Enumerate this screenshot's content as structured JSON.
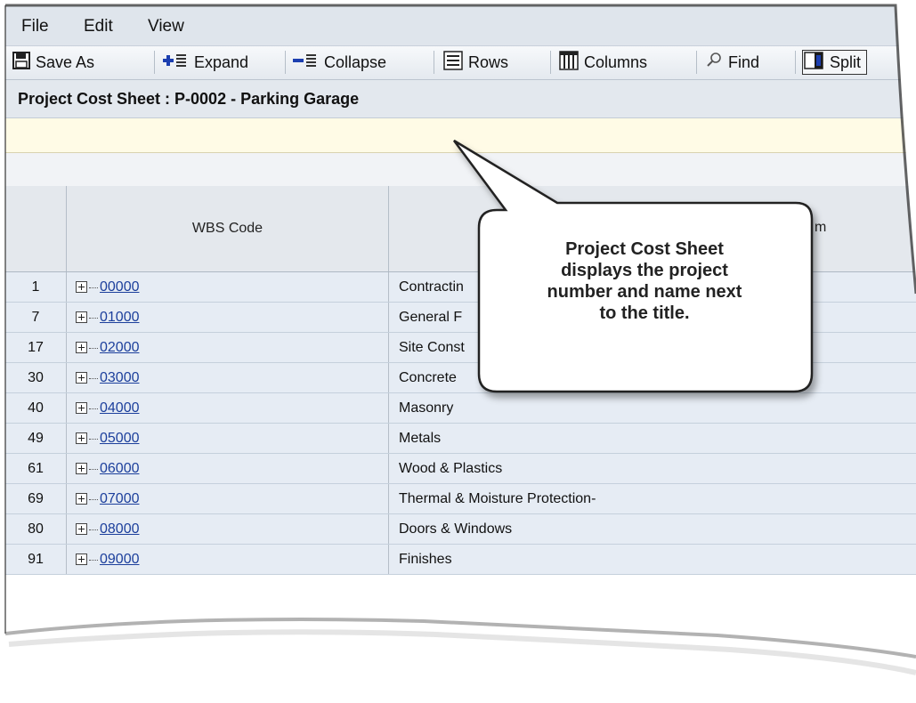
{
  "menu": {
    "items": [
      "File",
      "Edit",
      "View"
    ]
  },
  "toolbar": {
    "save_as": "Save As",
    "expand": "Expand",
    "collapse": "Collapse",
    "rows": "Rows",
    "columns": "Columns",
    "find": "Find",
    "split": "Split"
  },
  "page_title": "Project Cost Sheet : P-0002 - Parking Garage",
  "table": {
    "headers": {
      "wbs_code": "WBS Code",
      "description_partial": "m"
    },
    "rows": [
      {
        "num": "1",
        "wbs": "00000",
        "desc": "Contractin"
      },
      {
        "num": "7",
        "wbs": "01000",
        "desc": "General F"
      },
      {
        "num": "17",
        "wbs": "02000",
        "desc": "Site Const"
      },
      {
        "num": "30",
        "wbs": "03000",
        "desc": "Concrete"
      },
      {
        "num": "40",
        "wbs": "04000",
        "desc": "Masonry"
      },
      {
        "num": "49",
        "wbs": "05000",
        "desc": "Metals"
      },
      {
        "num": "61",
        "wbs": "06000",
        "desc": "Wood & Plastics"
      },
      {
        "num": "69",
        "wbs": "07000",
        "desc": "Thermal & Moisture Protection-"
      },
      {
        "num": "80",
        "wbs": "08000",
        "desc": "Doors & Windows"
      },
      {
        "num": "91",
        "wbs": "09000",
        "desc": "Finishes"
      }
    ]
  },
  "callout": {
    "lines": [
      "Project Cost Sheet",
      "displays the project",
      "number and name next",
      "to the title."
    ]
  },
  "colors": {
    "link": "#1c3f9c",
    "row_bg": "#e6ecf4",
    "info_strip": "#fffbe6"
  }
}
